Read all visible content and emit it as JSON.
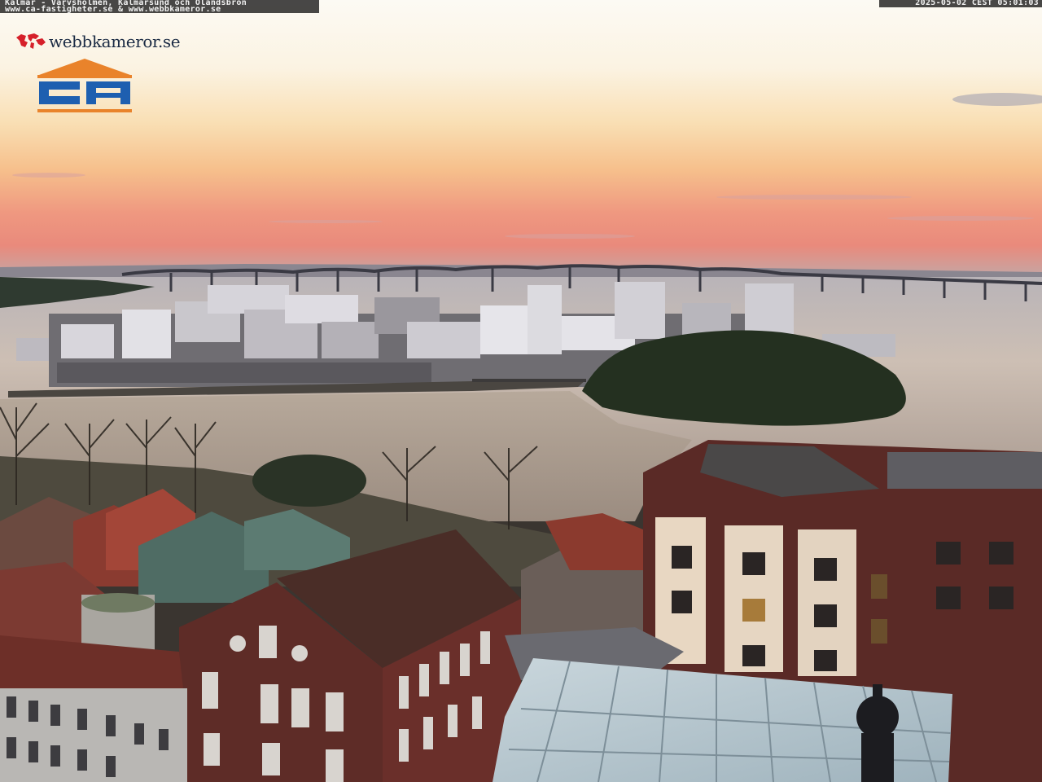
{
  "caption": {
    "line1": "Kalmar - Varvsholmen, Kalmarsund och Ölandsbron",
    "line2": "www.ca-fastigheter.se & www.webbkameror.se"
  },
  "timestamp": "2025-05-02 CEST 05:01:03",
  "watermark": {
    "brand": "webbkameror.se",
    "logo": "CA"
  },
  "colors": {
    "sky_top": "#fbf7ee",
    "sky_glow": "#f6c58a",
    "sunset_band": "#ef8a78",
    "water": "#c9b8a8",
    "brick": "#5a2a26",
    "logo_orange": "#e9832b",
    "logo_blue": "#1e5fb0"
  }
}
